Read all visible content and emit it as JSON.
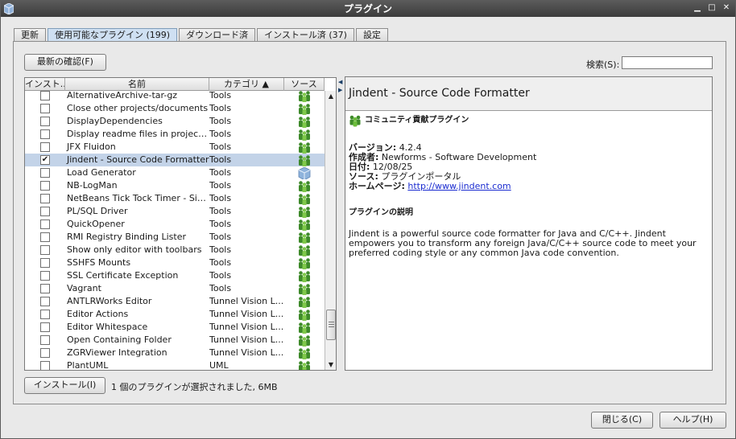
{
  "window": {
    "title": "プラグイン"
  },
  "tabs": [
    {
      "label": "更新",
      "active": false
    },
    {
      "label": "使用可能なプラグイン (199)",
      "active": true
    },
    {
      "label": "ダウンロード済",
      "active": false
    },
    {
      "label": "インストール済 (37)",
      "active": false
    },
    {
      "label": "設定",
      "active": false
    }
  ],
  "toolbar": {
    "check_newest_label": "最新の確認(F)"
  },
  "search": {
    "label": "検索(S):",
    "value": ""
  },
  "table": {
    "headers": [
      "インスト...",
      "名前",
      "カテゴリ ▲",
      "ソース"
    ],
    "rows": [
      {
        "checked": false,
        "name": "AlternativeArchive-tar-gz",
        "category": "Tools",
        "source": "community"
      },
      {
        "checked": false,
        "name": "Close other projects/documents",
        "category": "Tools",
        "source": "community"
      },
      {
        "checked": false,
        "name": "DisplayDependencies",
        "category": "Tools",
        "source": "community"
      },
      {
        "checked": false,
        "name": "Display readme files in project vi...",
        "category": "Tools",
        "source": "community"
      },
      {
        "checked": false,
        "name": "JFX Fluidon",
        "category": "Tools",
        "source": "community"
      },
      {
        "checked": true,
        "name": "Jindent - Source Code Formatter",
        "category": "Tools",
        "source": "community",
        "selected": true
      },
      {
        "checked": false,
        "name": "Load Generator",
        "category": "Tools",
        "source": "cube"
      },
      {
        "checked": false,
        "name": "NB-LogMan",
        "category": "Tools",
        "source": "community"
      },
      {
        "checked": false,
        "name": "NetBeans Tick Tock Timer - Sim...",
        "category": "Tools",
        "source": "community"
      },
      {
        "checked": false,
        "name": "PL/SQL Driver",
        "category": "Tools",
        "source": "community"
      },
      {
        "checked": false,
        "name": "QuickOpener",
        "category": "Tools",
        "source": "community"
      },
      {
        "checked": false,
        "name": "RMI Registry Binding Lister",
        "category": "Tools",
        "source": "community"
      },
      {
        "checked": false,
        "name": "Show only editor with toolbars",
        "category": "Tools",
        "source": "community"
      },
      {
        "checked": false,
        "name": "SSHFS Mounts",
        "category": "Tools",
        "source": "community"
      },
      {
        "checked": false,
        "name": "SSL Certificate Exception",
        "category": "Tools",
        "source": "community"
      },
      {
        "checked": false,
        "name": "Vagrant",
        "category": "Tools",
        "source": "community"
      },
      {
        "checked": false,
        "name": "ANTLRWorks Editor",
        "category": "Tunnel Vision L...",
        "source": "community"
      },
      {
        "checked": false,
        "name": "Editor Actions",
        "category": "Tunnel Vision L...",
        "source": "community"
      },
      {
        "checked": false,
        "name": "Editor Whitespace",
        "category": "Tunnel Vision L...",
        "source": "community"
      },
      {
        "checked": false,
        "name": "Open Containing Folder",
        "category": "Tunnel Vision L...",
        "source": "community"
      },
      {
        "checked": false,
        "name": "ZGRViewer Integration",
        "category": "Tunnel Vision L...",
        "source": "community"
      },
      {
        "checked": false,
        "name": "PlantUML",
        "category": "UML",
        "source": "community"
      }
    ]
  },
  "detail": {
    "title": "Jindent - Source Code Formatter",
    "badge": "コミュニティ貢献プラグイン",
    "version_label": "バージョン:",
    "version": "4.2.4",
    "author_label": "作成者:",
    "author": "Newforms - Software Development",
    "date_label": "日付:",
    "date": "12/08/25",
    "source_label": "ソース:",
    "source": "プラグインポータル",
    "homepage_label": "ホームページ:",
    "homepage": "http://www.jindent.com",
    "description_title": "プラグインの説明",
    "description": "Jindent is a powerful source code formatter for Java and C/C++. Jindent empowers you to transform any foreign Java/C/C++ source code to meet your preferred coding style or any common Java code convention."
  },
  "footer": {
    "install_label": "インストール(I)",
    "status": "1 個のプラグインが選択されました, 6MB",
    "close_label": "閉じる(C)",
    "help_label": "ヘルプ(H)"
  }
}
